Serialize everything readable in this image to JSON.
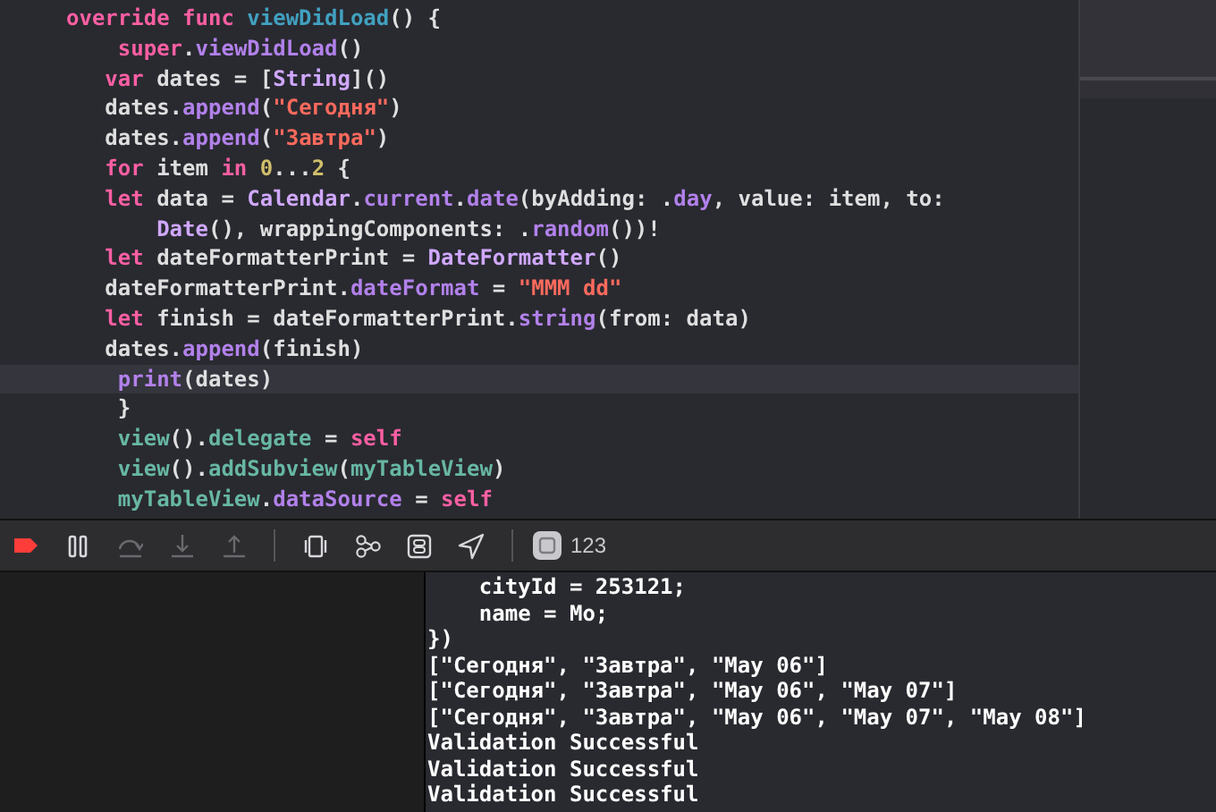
{
  "editor": {
    "lines": [
      {
        "current": false,
        "tokens": [
          {
            "kind": "kw",
            "text": "override"
          },
          {
            "kind": "kw",
            "text": " func"
          },
          {
            "kind": "decl",
            "text": " viewDidLoad"
          },
          {
            "kind": "plain",
            "text": "() {"
          }
        ]
      },
      {
        "current": false,
        "tokens": [
          {
            "kind": "kw",
            "text": "    super"
          },
          {
            "kind": "plain",
            "text": "."
          },
          {
            "kind": "method",
            "text": "viewDidLoad"
          },
          {
            "kind": "plain",
            "text": "()"
          }
        ]
      },
      {
        "current": false,
        "tokens": [
          {
            "kind": "kw",
            "text": "   var"
          },
          {
            "kind": "plain",
            "text": " dates = ["
          },
          {
            "kind": "type",
            "text": "String"
          },
          {
            "kind": "plain",
            "text": "]()"
          }
        ]
      },
      {
        "current": false,
        "tokens": [
          {
            "kind": "plain",
            "text": "   dates."
          },
          {
            "kind": "method",
            "text": "append"
          },
          {
            "kind": "plain",
            "text": "("
          },
          {
            "kind": "str",
            "text": "\"Сегодня\""
          },
          {
            "kind": "plain",
            "text": ")"
          }
        ]
      },
      {
        "current": false,
        "tokens": [
          {
            "kind": "plain",
            "text": "   dates."
          },
          {
            "kind": "method",
            "text": "append"
          },
          {
            "kind": "plain",
            "text": "("
          },
          {
            "kind": "str",
            "text": "\"Завтра\""
          },
          {
            "kind": "plain",
            "text": ")"
          }
        ]
      },
      {
        "current": false,
        "tokens": [
          {
            "kind": "kw",
            "text": "   for"
          },
          {
            "kind": "plain",
            "text": " item"
          },
          {
            "kind": "kw",
            "text": " in"
          },
          {
            "kind": "num",
            "text": " 0"
          },
          {
            "kind": "plain",
            "text": "..."
          },
          {
            "kind": "num",
            "text": "2"
          },
          {
            "kind": "plain",
            "text": " {"
          }
        ]
      },
      {
        "current": false,
        "tokens": [
          {
            "kind": "kw",
            "text": "   let"
          },
          {
            "kind": "plain",
            "text": " data ="
          },
          {
            "kind": "type",
            "text": " Calendar"
          },
          {
            "kind": "plain",
            "text": "."
          },
          {
            "kind": "method",
            "text": "current"
          },
          {
            "kind": "plain",
            "text": "."
          },
          {
            "kind": "method",
            "text": "date"
          },
          {
            "kind": "plain",
            "text": "(byAdding: ."
          },
          {
            "kind": "method",
            "text": "day"
          },
          {
            "kind": "plain",
            "text": ", value: item, to:"
          }
        ]
      },
      {
        "current": false,
        "tokens": [
          {
            "kind": "type",
            "text": "       Date"
          },
          {
            "kind": "plain",
            "text": "(), wrappingComponents: ."
          },
          {
            "kind": "method",
            "text": "random"
          },
          {
            "kind": "plain",
            "text": "())!"
          }
        ]
      },
      {
        "current": false,
        "tokens": [
          {
            "kind": "kw",
            "text": "   let"
          },
          {
            "kind": "plain",
            "text": " dateFormatterPrint ="
          },
          {
            "kind": "type",
            "text": " DateFormatter"
          },
          {
            "kind": "plain",
            "text": "()"
          }
        ]
      },
      {
        "current": false,
        "tokens": [
          {
            "kind": "plain",
            "text": "   dateFormatterPrint."
          },
          {
            "kind": "method",
            "text": "dateFormat"
          },
          {
            "kind": "plain",
            "text": " ="
          },
          {
            "kind": "str",
            "text": " \"MMM dd\""
          }
        ]
      },
      {
        "current": false,
        "tokens": [
          {
            "kind": "kw",
            "text": "   let"
          },
          {
            "kind": "plain",
            "text": " finish = dateFormatterPrint."
          },
          {
            "kind": "method",
            "text": "string"
          },
          {
            "kind": "plain",
            "text": "(from: data)"
          }
        ]
      },
      {
        "current": false,
        "tokens": [
          {
            "kind": "plain",
            "text": "   dates."
          },
          {
            "kind": "method",
            "text": "append"
          },
          {
            "kind": "plain",
            "text": "(finish)"
          }
        ]
      },
      {
        "current": true,
        "tokens": [
          {
            "kind": "method",
            "text": "    print"
          },
          {
            "kind": "plain",
            "text": "(dates)"
          }
        ]
      },
      {
        "current": false,
        "tokens": [
          {
            "kind": "plain",
            "text": "    }"
          }
        ]
      },
      {
        "current": false,
        "tokens": [
          {
            "kind": "local",
            "text": "    view"
          },
          {
            "kind": "plain",
            "text": "()."
          },
          {
            "kind": "local",
            "text": "delegate"
          },
          {
            "kind": "plain",
            "text": " ="
          },
          {
            "kind": "kw",
            "text": " self"
          }
        ]
      },
      {
        "current": false,
        "tokens": [
          {
            "kind": "local",
            "text": "    view"
          },
          {
            "kind": "plain",
            "text": "()."
          },
          {
            "kind": "local",
            "text": "addSubview"
          },
          {
            "kind": "plain",
            "text": "("
          },
          {
            "kind": "local",
            "text": "myTableView"
          },
          {
            "kind": "plain",
            "text": ")"
          }
        ]
      },
      {
        "current": false,
        "tokens": [
          {
            "kind": "local",
            "text": "    myTableView"
          },
          {
            "kind": "plain",
            "text": "."
          },
          {
            "kind": "method",
            "text": "dataSource"
          },
          {
            "kind": "plain",
            "text": " ="
          },
          {
            "kind": "kw",
            "text": " self"
          }
        ]
      }
    ]
  },
  "debug_bar": {
    "buttons": [
      {
        "kind": "breakpoints",
        "disabled": false
      },
      {
        "kind": "pause",
        "disabled": false
      },
      {
        "kind": "step-over",
        "disabled": true
      },
      {
        "kind": "step-into",
        "disabled": true
      },
      {
        "kind": "step-out",
        "disabled": true
      },
      {
        "kind": "divider"
      },
      {
        "kind": "view-hierarchy",
        "disabled": false
      },
      {
        "kind": "memory-graph",
        "disabled": false
      },
      {
        "kind": "environment",
        "disabled": false
      },
      {
        "kind": "location",
        "disabled": false
      },
      {
        "kind": "divider"
      }
    ],
    "process": {
      "label": "123"
    }
  },
  "console": {
    "lines": [
      "    cityId = 253121;",
      "    name = Mo;",
      "})",
      "[\"Сегодня\", \"Завтра\", \"May 06\"]",
      "[\"Сегодня\", \"Завтра\", \"May 06\", \"May 07\"]",
      "[\"Сегодня\", \"Завтра\", \"May 06\", \"May 07\", \"May 08\"]",
      "Validation Successful",
      "Validation Successful",
      "Validation Successful"
    ]
  }
}
